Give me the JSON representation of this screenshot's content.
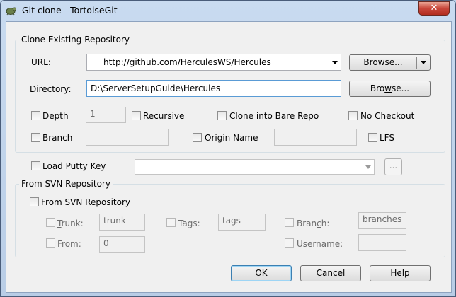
{
  "window": {
    "title": "Git clone - TortoiseGit",
    "close_glyph": "✕"
  },
  "clone_group": {
    "label": "Clone Existing Repository",
    "url": {
      "label_prefix": "",
      "label_underlined": "U",
      "label_rest": "RL:",
      "value": "http://github.com/HerculesWS/Hercules"
    },
    "url_browse": {
      "label_prefix": "",
      "label_underlined": "B",
      "label_rest": "rowse..."
    },
    "directory": {
      "label_prefix": "",
      "label_underlined": "D",
      "label_rest": "irectory:",
      "value": "D:\\ServerSetupGuide\\Hercules"
    },
    "dir_browse": {
      "label_prefix": "Bro",
      "label_underlined": "w",
      "label_rest": "se..."
    },
    "depth": {
      "label": "Depth",
      "value": "1",
      "checked": false
    },
    "recursive": {
      "label": "Recursive",
      "checked": false
    },
    "bare": {
      "label": "Clone into Bare Repo",
      "checked": false
    },
    "no_checkout": {
      "label": "No Checkout",
      "checked": false
    },
    "branch": {
      "label": "Branch",
      "value": "",
      "checked": false
    },
    "origin_name": {
      "label": "Origin Name",
      "value": "",
      "checked": false
    },
    "lfs": {
      "label": "LFS",
      "checked": false
    }
  },
  "putty": {
    "label_prefix": "Load Putty ",
    "label_underlined": "K",
    "label_rest": "ey",
    "value": "",
    "browse_label": "...",
    "checked": false
  },
  "svn_group": {
    "label": "From SVN Repository",
    "from_svn": {
      "label_prefix": "From ",
      "label_underlined": "S",
      "label_rest": "VN Repository",
      "checked": false
    },
    "trunk": {
      "label_prefix": "",
      "label_underlined": "T",
      "label_rest": "runk:",
      "value": "trunk"
    },
    "tags": {
      "label": "Tags:",
      "value": "tags"
    },
    "branch": {
      "label_prefix": "Bran",
      "label_underlined": "c",
      "label_rest": "h:",
      "value": "branches"
    },
    "from": {
      "label_prefix": "",
      "label_underlined": "F",
      "label_rest": "rom:",
      "value": "0"
    },
    "username": {
      "label_prefix": "User",
      "label_underlined": "n",
      "label_rest": "ame:",
      "value": ""
    }
  },
  "buttons": {
    "ok": "OK",
    "cancel": "Cancel",
    "help": "Help"
  }
}
